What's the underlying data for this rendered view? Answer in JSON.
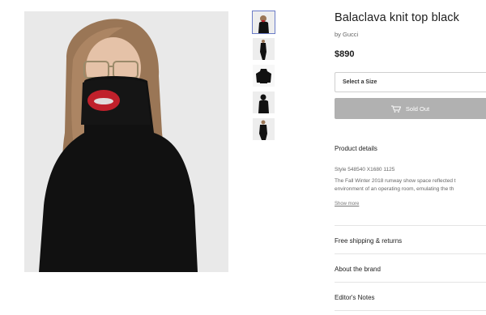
{
  "product": {
    "title": "Balaclava knit top black",
    "brand_prefix": "by",
    "brand": "Gucci",
    "price": "$890"
  },
  "size_select": {
    "label": "Select a Size"
  },
  "cta": {
    "label": "Sold Out",
    "icon": "shopping-cart-icon"
  },
  "details": {
    "title": "Product details",
    "style": "Style 548540 X1680 1125",
    "description_lines": [
      "The Fall Winter 2018 runway show space reflected t",
      "environment of an operating room, emulating the th"
    ],
    "show_more": "Show more"
  },
  "accordion": [
    {
      "label": "Free shipping & returns"
    },
    {
      "label": "About the brand"
    },
    {
      "label": "Editor's Notes"
    }
  ],
  "thumbnails": [
    "front-view",
    "full-length",
    "flat-lay",
    "back-view",
    "full-length-walk"
  ],
  "colors": {
    "sold_out_bg": "#b1b1b1",
    "active_thumb": "#6b7cc7",
    "garment": "#111111",
    "lip_cutout": "#c0202b",
    "hair": "#9a7656"
  }
}
